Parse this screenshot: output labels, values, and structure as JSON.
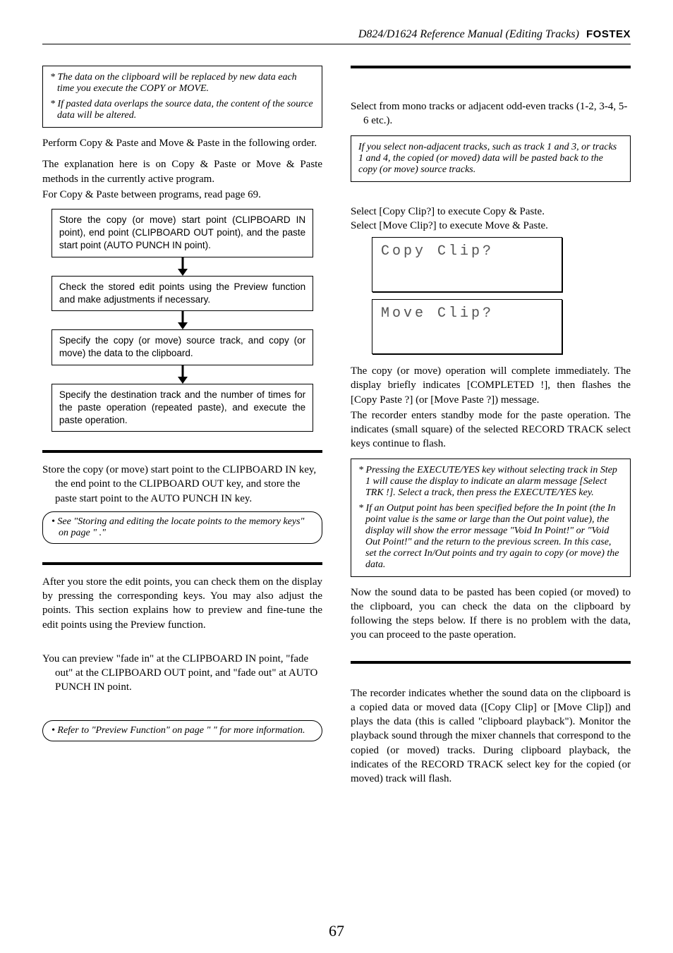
{
  "header": {
    "title": "D824/D1624 Reference Manual (Editing Tracks)",
    "brand": "FOSTEX"
  },
  "left": {
    "notes": [
      "* The data on the clipboard will be replaced by new data each time you execute the COPY or MOVE.",
      "* If pasted data overlaps the source data, the content of the source data will be altered."
    ],
    "intro1": "Perform Copy & Paste and Move & Paste in the following order.",
    "intro2": "The explanation here is on Copy & Paste or Move & Paste methods in the currently active program.",
    "intro3": "For Copy & Paste between programs, read page 69.",
    "flow": [
      "Store the copy (or move) start point (CLIPBOARD IN point), end point (CLIPBOARD OUT point), and the paste start point (AUTO PUNCH IN point).",
      "Check the stored edit points using the Preview function and make adjustments if necessary.",
      "Specify the copy (or move) source track, and copy (or move) the data to the clipboard.",
      "Specify the destination track and the number of times for the paste operation (repeated paste), and execute the paste operation."
    ],
    "step_store": "Store the copy (or move) start point to the CLIPBOARD IN key, the end point to the CLIPBOARD OUT key, and store the paste start point to the AUTO PUNCH IN key.",
    "round_store": "• See \"Storing and editing the locate points to the memory keys\" on page \"   .\"",
    "preview_intro": "After you store the edit points, you can check them on the display by pressing the corresponding keys. You may also adjust the points. This section explains how to preview and fine-tune the edit points using the Preview function.",
    "preview_step": "You can preview \"fade in\" at the CLIPBOARD IN point, \"fade out\" at the CLIPBOARD OUT point, and \"fade out\" at AUTO PUNCH IN point.",
    "round_preview": "• Refer to \"Preview Function\" on page \"    \" for more information."
  },
  "right": {
    "step_tracks": "Select from mono tracks or adjacent odd-even tracks (1-2, 3-4, 5-6 etc.).",
    "note_tracks": "If you select non-adjacent tracks, such as track 1 and 3, or tracks 1 and 4, the copied (or moved) data will be pasted back to the copy (or move) source tracks.",
    "step_select1": "Select [Copy Clip?] to execute Copy & Paste.",
    "step_select2": "Select [Move Clip?] to execute Move & Paste.",
    "lcd1": "Copy Clip?",
    "lcd2": "Move Clip?",
    "result1": "The copy (or move) operation will complete immediately. The display briefly indicates [COMPLETED !], then flashes the [Copy Paste ?] (or [Move Paste ?]) message.",
    "result2": "The recorder enters standby mode for the paste operation.  The indicates (small square) of the selected RECORD TRACK select keys continue to flash.",
    "warn": [
      "* Pressing the EXECUTE/YES key without selecting track in Step 1 will cause the display to indicate an alarm message [Select TRK !].  Select a track, then press the EXECUTE/YES key.",
      "* If an Output point has been specified before the In point (the In point value is the same or large than the Out point value), the display will show the error message \"Void In Point!\" or \"Void Out Point!\" and the return to the previous screen.  In this case, set the correct In/Out points and try again to copy (or move) the data."
    ],
    "after_warn": "Now the sound data to be pasted has been copied (or moved) to the clipboard, you can check the data on the clipboard by following the steps below.  If there is no problem with the data, you can proceed to the paste operation.",
    "bottom": "The recorder indicates whether the sound data on the clipboard is a copied data or moved data ([Copy Clip] or [Move Clip]) and plays the data (this is called \"clipboard playback\").  Monitor the playback sound through the mixer channels that correspond to the copied (or moved) tracks. During clipboard playback, the indicates of the RECORD TRACK select key for the copied (or moved) track will flash."
  },
  "page": "67"
}
